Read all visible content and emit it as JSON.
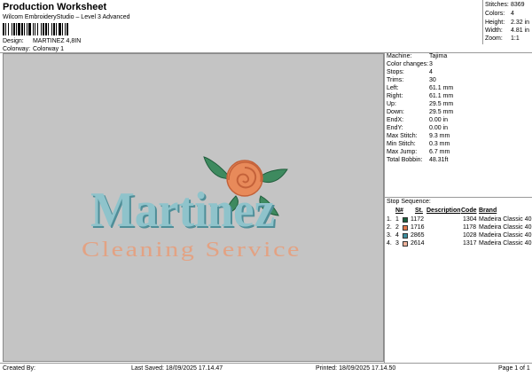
{
  "header": {
    "title": "Production Worksheet",
    "subtitle": "Wilcom EmbroideryStudio – Level 3 Advanced",
    "design_label": "Design:",
    "design_value": "MARTINEZ 4,8IN",
    "colorway_label": "Colorway:",
    "colorway_value": "Colorway 1"
  },
  "summary": {
    "stitches_label": "Stitches:",
    "stitches": "8369",
    "colors_label": "Colors:",
    "colors": "4",
    "height_label": "Height:",
    "height": "2.32 in",
    "width_label": "Width:",
    "width": "4.81 in",
    "zoom_label": "Zoom:",
    "zoom": "1:1"
  },
  "design": {
    "line1": "Martinez",
    "line2": "Cleaning Service",
    "colors": {
      "text1": "#8fc3cb",
      "text1_shadow": "#4f8e98",
      "text2": "#e3a283",
      "rose": "#e88a5a",
      "rose_dark": "#c4623a",
      "leaf": "#3e8a5f",
      "leaf_dark": "#1f5c3b"
    }
  },
  "machine": {
    "machine_label": "Machine:",
    "machine": "Tajima",
    "color_changes_label": "Color changes:",
    "color_changes": "3",
    "stops_label": "Stops:",
    "stops": "4",
    "trims_label": "Trims:",
    "trims": "30",
    "left_label": "Left:",
    "left": "61.1 mm",
    "right_label": "Right:",
    "right": "61.1 mm",
    "up_label": "Up:",
    "up": "29.5 mm",
    "down_label": "Down:",
    "down": "29.5 mm",
    "endx_label": "EndX:",
    "endx": "0.00 in",
    "endy_label": "EndY:",
    "endy": "0.00 in",
    "max_stitch_label": "Max Stitch:",
    "max_stitch": "9.3 mm",
    "min_stitch_label": "Min Stitch:",
    "min_stitch": "0.3 mm",
    "max_jump_label": "Max Jump:",
    "max_jump": "6.7 mm",
    "total_bobbin_label": "Total Bobbin:",
    "total_bobbin": "48.31ft"
  },
  "stop_sequence": {
    "title": "Stop Sequence:",
    "headers": {
      "n": "N#",
      "st": "St.",
      "description": "Description",
      "code": "Code",
      "brand": "Brand"
    },
    "rows": [
      {
        "idx": "1.",
        "n": "1",
        "color": "#1a5e3c",
        "st": "1172",
        "description": "",
        "code": "1304",
        "brand": "Madeira Classic 40"
      },
      {
        "idx": "2.",
        "n": "2",
        "color": "#e2784a",
        "st": "1716",
        "description": "",
        "code": "1178",
        "brand": "Madeira Classic 40"
      },
      {
        "idx": "3.",
        "n": "4",
        "color": "#3e8fa0",
        "st": "2865",
        "description": "",
        "code": "1028",
        "brand": "Madeira Classic 40"
      },
      {
        "idx": "4.",
        "n": "3",
        "color": "#f0b39b",
        "st": "2614",
        "description": "",
        "code": "1317",
        "brand": "Madeira Classic 40"
      }
    ]
  },
  "footer": {
    "created_by": "Created By:",
    "last_saved": "Last Saved: 18/09/2025 17.14.47",
    "printed": "Printed: 18/09/2025 17.14.50",
    "page": "Page 1 of 1"
  }
}
